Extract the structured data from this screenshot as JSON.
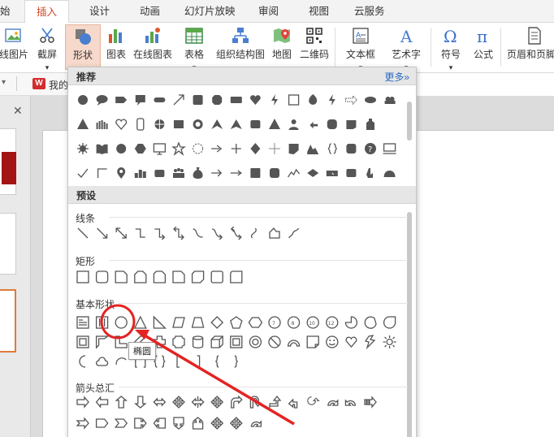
{
  "tabs": [
    {
      "label": "始",
      "active": false
    },
    {
      "label": "插入",
      "active": true
    },
    {
      "label": "设计",
      "active": false
    },
    {
      "label": "动画",
      "active": false
    },
    {
      "label": "幻灯片放映",
      "active": false
    },
    {
      "label": "审阅",
      "active": false
    },
    {
      "label": "视图",
      "active": false
    },
    {
      "label": "云服务",
      "active": false
    }
  ],
  "ribbon": {
    "online_picture": "线图片",
    "screenshot": "截屏",
    "shapes": "形状",
    "chart": "图表",
    "online_chart": "在线图表",
    "table": "表格",
    "org_chart": "组织结构图",
    "map": "地图",
    "qrcode": "二维码",
    "textbox": "文本框",
    "wordart": "艺术字",
    "symbol": "符号",
    "formula": "公式",
    "header_footer": "页眉和页脚"
  },
  "quick_bar": {
    "doc_label": "我的"
  },
  "dropdown": {
    "recommended_title": "推荐",
    "more_link": "更多»",
    "presets_title": "预设",
    "lines_label": "线条",
    "rect_label": "矩形",
    "basic_label": "基本形状",
    "arrows_label": "箭头总汇"
  },
  "tooltip": {
    "text": "椭圆"
  },
  "colors": {
    "accent": "#d24726",
    "link": "#2d6bc4",
    "icon": "#555555",
    "annotation": "#e52222"
  }
}
